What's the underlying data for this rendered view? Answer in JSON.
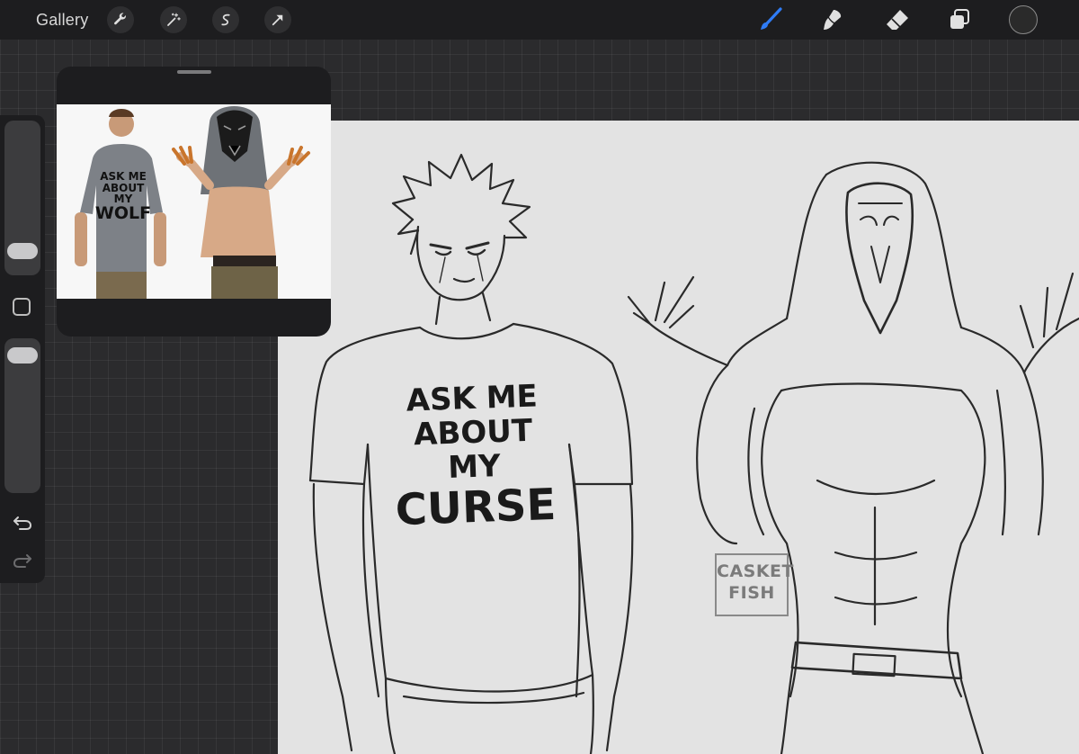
{
  "toolbar": {
    "gallery_label": "Gallery",
    "left_tools": [
      "wrench-icon",
      "magic-wand-icon",
      "selection-icon",
      "transform-arrow-icon"
    ],
    "right_tools": [
      "brush-icon",
      "smudge-icon",
      "eraser-icon",
      "layers-icon"
    ],
    "active_tool": "brush-icon",
    "accent_color": "#2f7cf6",
    "current_color": "#2a2a2a"
  },
  "sidebar": {
    "brush_size_level": 0.1,
    "opacity_level": 0.95,
    "modify_button": "square-icon",
    "undo_icon": "undo-icon",
    "redo_icon": "redo-icon"
  },
  "reference": {
    "shirt_text_lines": [
      "ASK ME",
      "ABOUT MY",
      "WOLF"
    ]
  },
  "canvas": {
    "shirt_text_lines": [
      "ASK ME",
      "ABOUT MY",
      "CURSE"
    ],
    "watermark_lines": [
      "CASKET",
      "FISH"
    ],
    "background": "#e3e3e3"
  }
}
